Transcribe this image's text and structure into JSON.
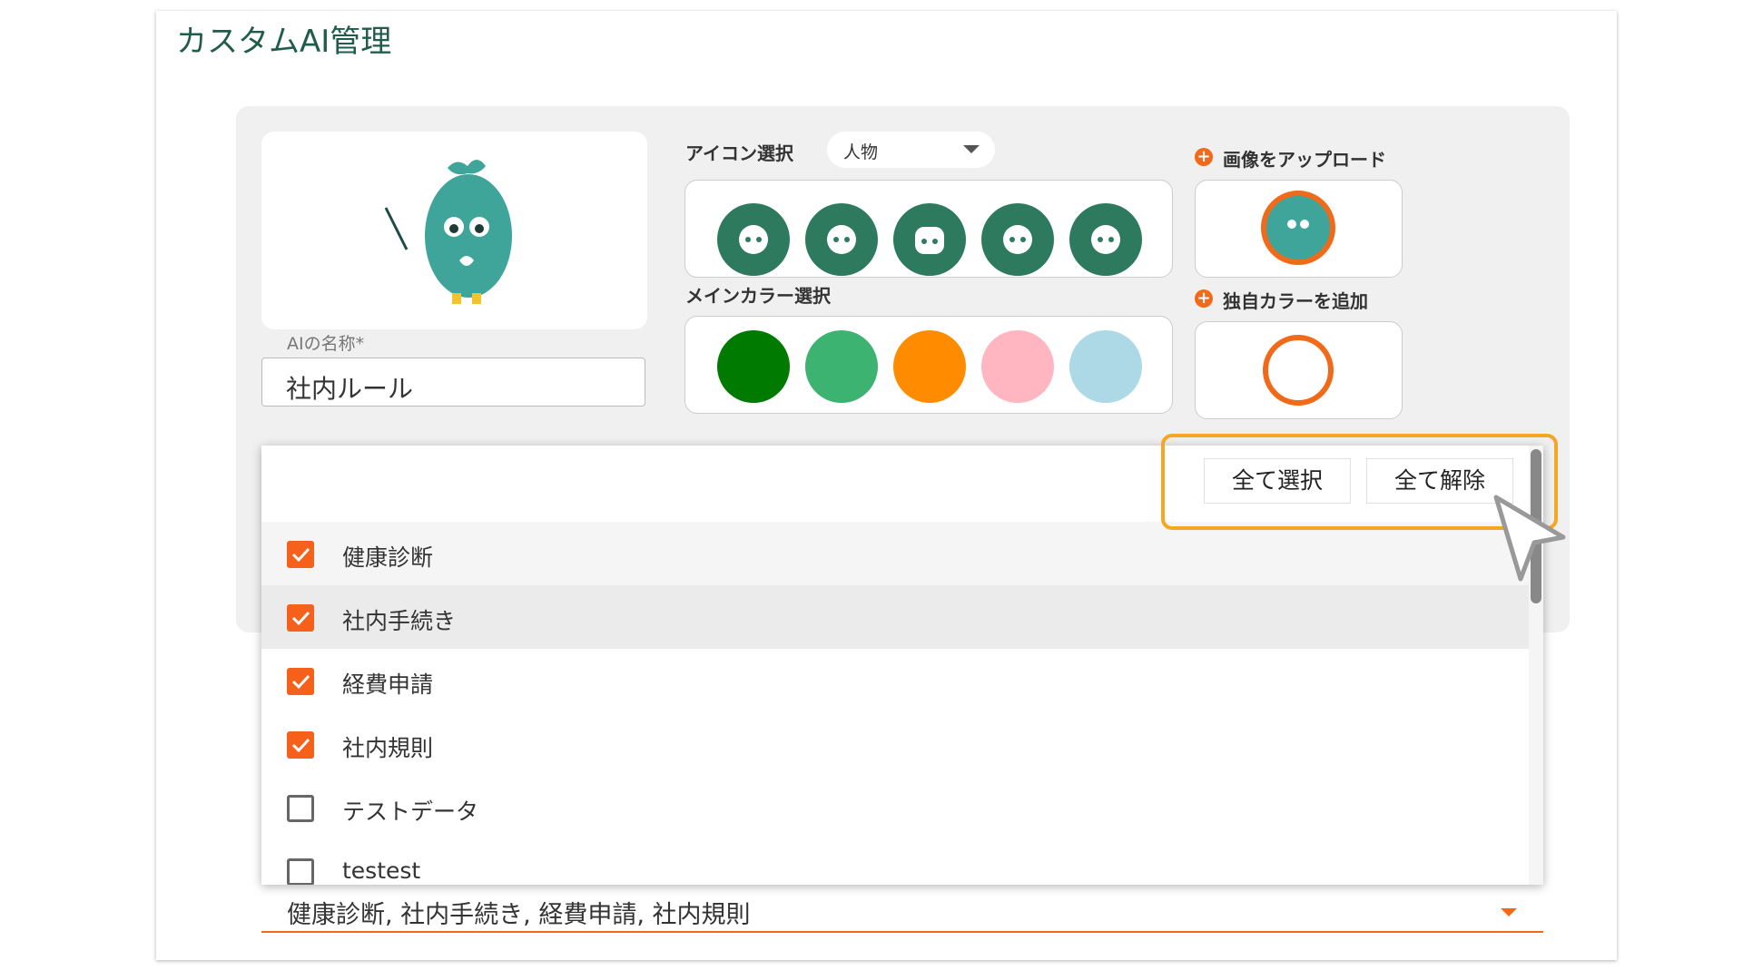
{
  "page": {
    "title": "カスタムAI管理"
  },
  "form": {
    "name_label": "AIの名称*",
    "name_value": "社内ルール",
    "icon_select_label": "アイコン選択",
    "icon_category": "人物",
    "icon_options": [
      "person-icon-1",
      "person-icon-2",
      "person-icon-3",
      "person-icon-4",
      "person-icon-5"
    ],
    "main_color_label": "メインカラー選択",
    "colors": [
      "#007a00",
      "#3cb371",
      "#ff8c00",
      "#ffb6c1",
      "#add8e6"
    ],
    "upload_label": "画像をアップロード",
    "add_color_label": "独自カラーを追加",
    "accent_color": "#f06a1a"
  },
  "dropdown": {
    "select_all": "全て選択",
    "deselect_all": "全て解除",
    "items": [
      {
        "label": "健康診断",
        "checked": true
      },
      {
        "label": "社内手続き",
        "checked": true
      },
      {
        "label": "経費申請",
        "checked": true
      },
      {
        "label": "社内規則",
        "checked": true
      },
      {
        "label": "テストデータ",
        "checked": false
      },
      {
        "label": "testest",
        "checked": false
      }
    ],
    "selected_value": "健康診断, 社内手続き, 経費申請, 社内規則"
  }
}
